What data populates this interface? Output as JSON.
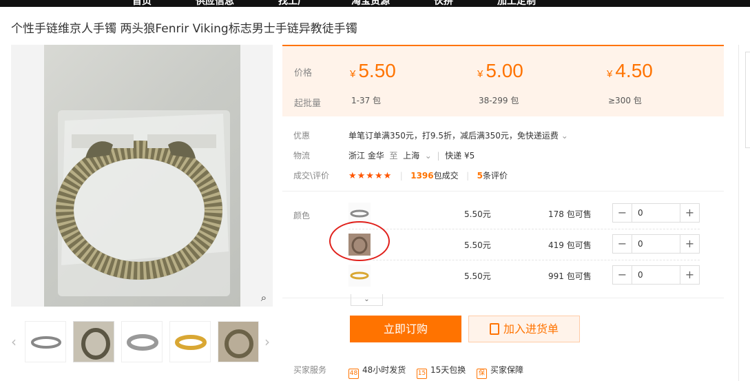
{
  "topbar": {
    "nav": [
      "首页",
      "供应信息",
      "找工厂",
      "淘宝货源",
      "伙拼",
      "加工定制"
    ]
  },
  "product": {
    "title": "个性手链维京人手镯 两头狼Fenrir Viking标志男士手链异教徒手镯"
  },
  "gallery": {
    "zoom_icon": "search-icon",
    "thumbnail_count": 5
  },
  "pricing": {
    "price_label": "价格",
    "moq_label": "起批量",
    "currency": "¥",
    "tiers": [
      {
        "price": "5.50",
        "range": "1-37 包"
      },
      {
        "price": "5.00",
        "range": "38-299 包"
      },
      {
        "price": "4.50",
        "range": "≥300 包"
      }
    ]
  },
  "promo": {
    "label": "优惠",
    "text": "单笔订单满350元，打9.5折，减后满350元，免快递运费"
  },
  "logistics": {
    "label": "物流",
    "from": "浙江 金华",
    "to_word": "至",
    "to": "上海",
    "method": "快递 ¥5"
  },
  "deals": {
    "label": "成交\\评价",
    "stars": "★★★★★",
    "count": "1396",
    "count_unit": "包成交",
    "reviews": "5",
    "reviews_unit": "条评价"
  },
  "sku": {
    "label": "颜色",
    "items": [
      {
        "price": "5.50元",
        "stock": "178 包可售",
        "qty": "0"
      },
      {
        "price": "5.50元",
        "stock": "419 包可售",
        "qty": "0"
      },
      {
        "price": "5.50元",
        "stock": "991 包可售",
        "qty": "0"
      }
    ]
  },
  "actions": {
    "order": "立即订购",
    "add_cart": "加入进货单"
  },
  "services": {
    "label": "买家服务",
    "items": [
      "48小时发货",
      "15天包换",
      "买家保障"
    ]
  },
  "colors": {
    "accent": "#ff7300",
    "price_bg": "#fff3ea",
    "annotation": "#e0201b"
  }
}
